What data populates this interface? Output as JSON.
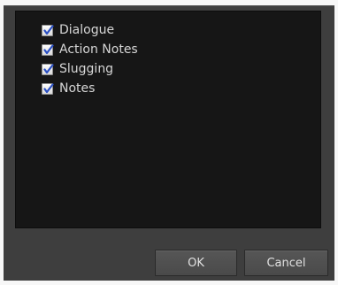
{
  "options": [
    {
      "label": "Dialogue",
      "checked": true
    },
    {
      "label": "Action Notes",
      "checked": true
    },
    {
      "label": "Slugging",
      "checked": true
    },
    {
      "label": "Notes",
      "checked": true
    }
  ],
  "buttons": {
    "ok_label": "OK",
    "cancel_label": "Cancel"
  },
  "colors": {
    "checkmark": "#2a4fc4",
    "dialog_background": "#3e3e3e",
    "list_background": "#161616"
  },
  "icons": {
    "checkbox": "checkmark-icon"
  }
}
